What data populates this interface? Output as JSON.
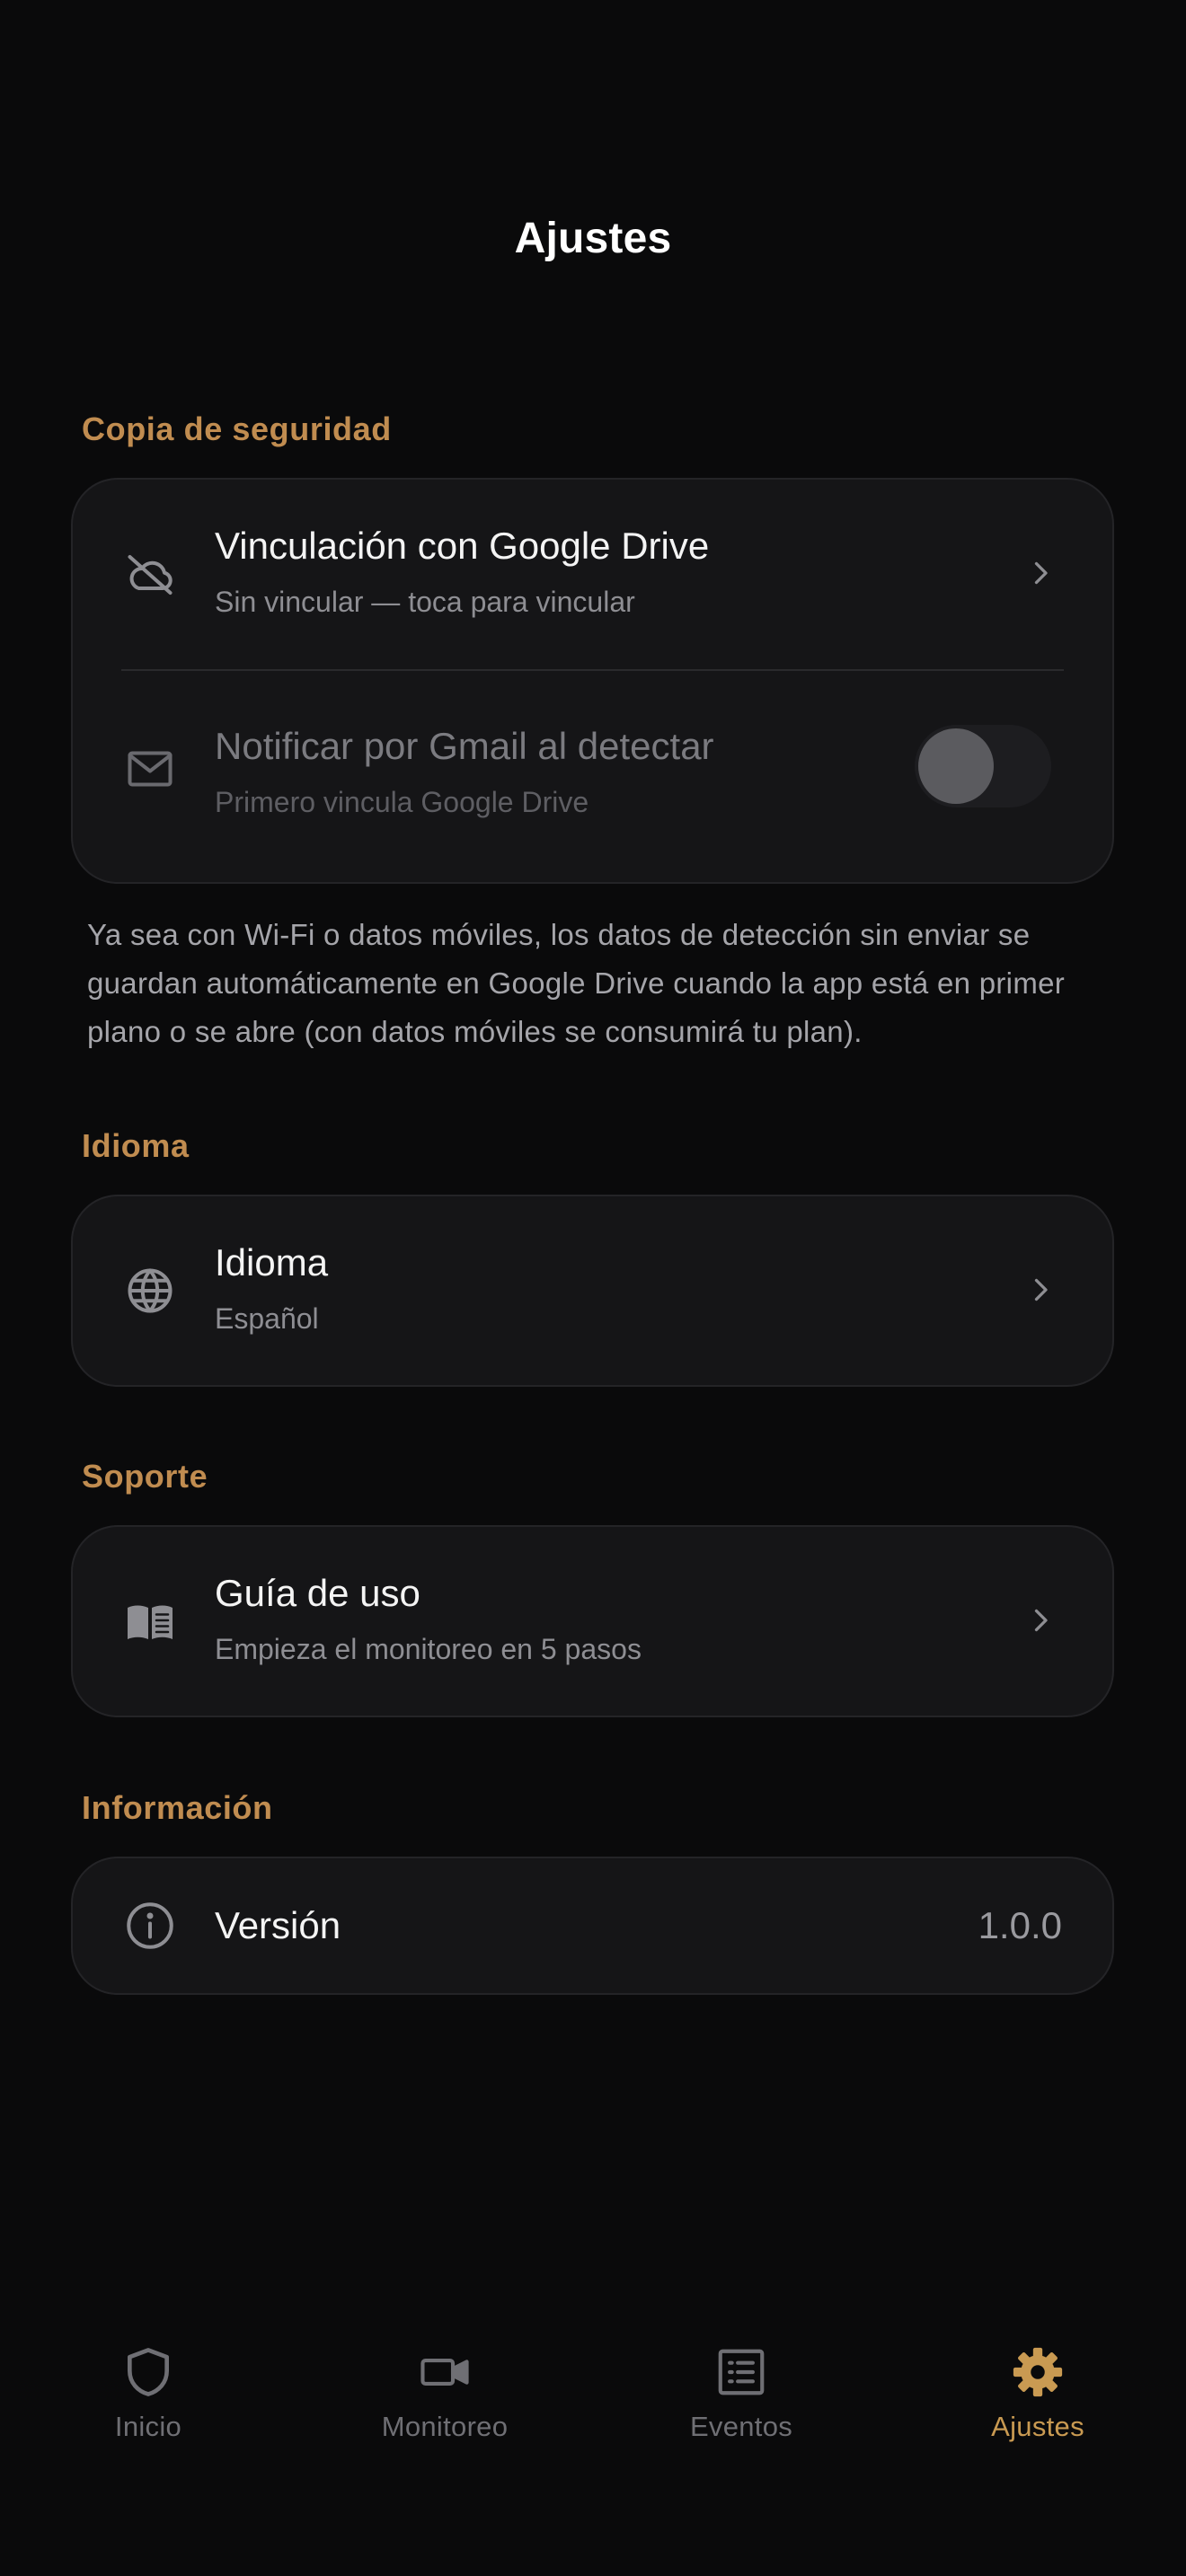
{
  "header": {
    "title": "Ajustes"
  },
  "backup": {
    "section_title": "Copia de seguridad",
    "drive": {
      "title": "Vinculación con Google Drive",
      "subtitle": "Sin vincular — toca para vincular",
      "icon": "cloud-off-icon"
    },
    "gmail": {
      "title": "Notificar por Gmail al detectar",
      "subtitle": "Primero vincula Google Drive",
      "icon": "mail-icon",
      "enabled": false,
      "toggle_on": false
    },
    "note": "Ya sea con Wi-Fi o datos móviles, los datos de detección sin enviar se guardan automáticamente en Google Drive cuando la app está en primer plano o se abre (con datos móviles se consumirá tu plan)."
  },
  "language": {
    "section_title": "Idioma",
    "item": {
      "title": "Idioma",
      "subtitle": "Español",
      "icon": "globe-icon"
    }
  },
  "support": {
    "section_title": "Soporte",
    "item": {
      "title": "Guía de uso",
      "subtitle": "Empieza el monitoreo en 5 pasos",
      "icon": "book-icon"
    }
  },
  "info": {
    "section_title": "Información",
    "item": {
      "title": "Versión",
      "value": "1.0.0",
      "icon": "info-icon"
    }
  },
  "tabbar": {
    "active": "settings",
    "tabs": [
      {
        "id": "home",
        "label": "Inicio",
        "icon": "shield-icon"
      },
      {
        "id": "monitor",
        "label": "Monitoreo",
        "icon": "video-camera-icon"
      },
      {
        "id": "events",
        "label": "Eventos",
        "icon": "list-icon"
      },
      {
        "id": "settings",
        "label": "Ajustes",
        "icon": "gear-icon"
      }
    ]
  },
  "colors": {
    "background": "#0a0a0b",
    "card": "#151517",
    "accent": "#c08c50",
    "tab_active": "#c99a52",
    "tab_inactive": "#6f6f74"
  }
}
